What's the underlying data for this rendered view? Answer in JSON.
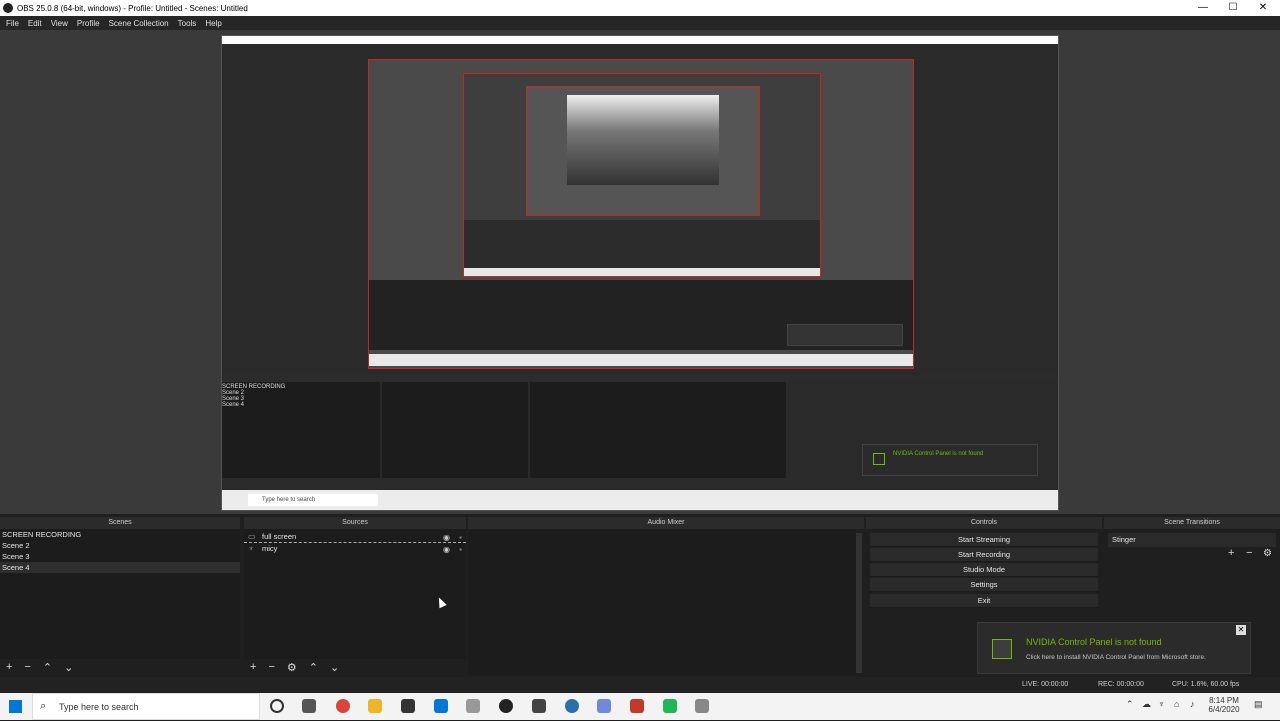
{
  "window": {
    "title": "OBS 25.0.8 (64-bit, windows) - Profile: Untitled - Scenes: Untitled",
    "min": "—",
    "max": "☐",
    "close": "✕"
  },
  "menu": [
    "File",
    "Edit",
    "View",
    "Profile",
    "Scene Collection",
    "Tools",
    "Help"
  ],
  "panels": {
    "scenes": "Scenes",
    "sources": "Sources",
    "audio": "Audio Mixer",
    "controls": "Controls",
    "transitions": "Scene Transitions"
  },
  "scenes": [
    "SCREEN RECORDING",
    "Scene 2",
    "Scene 3",
    "Scene 4"
  ],
  "sources": [
    {
      "name": "full screen",
      "icon": "monitor-icon"
    },
    {
      "name": "micy",
      "icon": "mic-icon"
    }
  ],
  "controls": [
    "Start Streaming",
    "Start Recording",
    "Studio Mode",
    "Settings",
    "Exit"
  ],
  "transition": {
    "selected": "Stinger"
  },
  "notification": {
    "title": "NVIDIA Control Panel is not found",
    "sub": "Click here to install NVIDIA Control Panel from Microsoft store."
  },
  "status": {
    "live": "LIVE: 00:00:00",
    "rec": "REC: 00:00:00",
    "cpu": "CPU: 1.6%, 60.00 fps"
  },
  "taskbar": {
    "search": "Type here to search",
    "time": "8:14 PM",
    "date": "6/4/2020"
  },
  "colors": {
    "accent_green": "#76b900",
    "red_frame": "#d02020"
  }
}
